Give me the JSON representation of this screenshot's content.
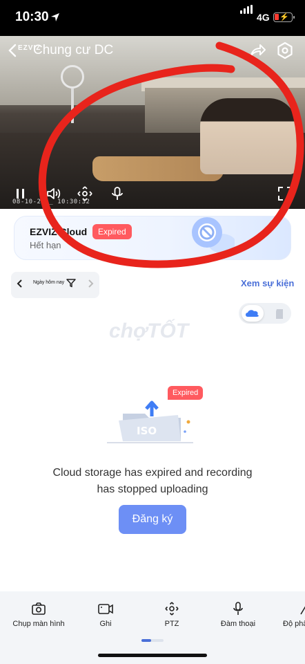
{
  "status_bar": {
    "time": "10:30",
    "network": "4G"
  },
  "header": {
    "brand": "EZVIZ",
    "title": "Chung cư DC"
  },
  "video": {
    "timestamp": "08-10-20__ 10:30:32"
  },
  "cloud_card": {
    "title": "EZVIZ Cloud",
    "subtitle": "Hết hạn",
    "badge": "Expired"
  },
  "date_filter": {
    "label": "Ngày hôm nay"
  },
  "events_link": "Xem sự kiện",
  "watermark": "chợTỐT",
  "empty_state": {
    "badge": "Expired",
    "art_label": "ISO",
    "message_line1": "Cloud storage has expired and recording",
    "message_line2": "has stopped uploading",
    "register_button": "Đăng ký"
  },
  "toolbar": {
    "items": [
      {
        "label": "Chụp màn hình",
        "icon": "camera-icon"
      },
      {
        "label": "Ghi",
        "icon": "video-record-icon"
      },
      {
        "label": "PTZ",
        "icon": "ptz-icon"
      },
      {
        "label": "Đàm thoại",
        "icon": "microphone-icon"
      },
      {
        "label": "Độ phâ",
        "icon": "resolution-icon"
      }
    ]
  },
  "colors": {
    "accent": "#4a6fd8",
    "expired": "#ff5a5f",
    "button": "#6d8ff5",
    "annotation": "#e8241c"
  }
}
